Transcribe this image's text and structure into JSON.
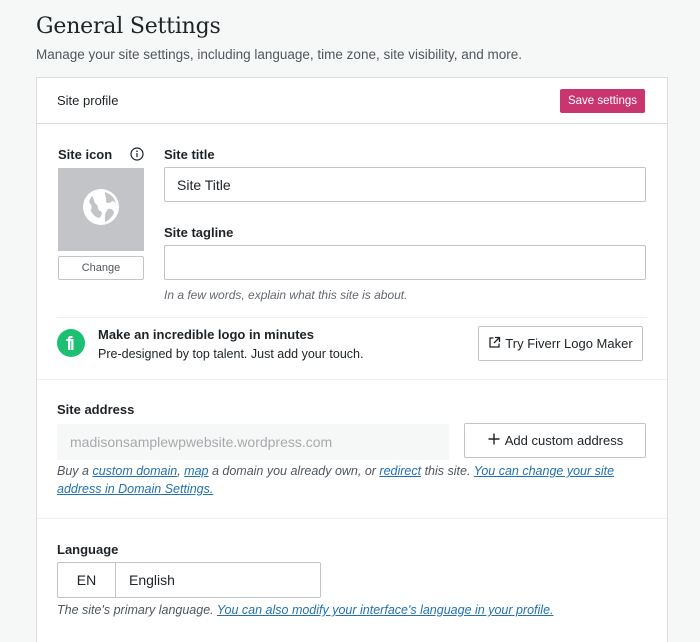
{
  "page": {
    "title": "General Settings",
    "subtitle": "Manage your site settings, including language, time zone, site visibility, and more."
  },
  "site_profile": {
    "header": "Site profile",
    "save_label": "Save settings",
    "site_icon_label": "Site icon",
    "change_label": "Change",
    "site_title_label": "Site title",
    "site_title_value": "Site Title",
    "tagline_label": "Site tagline",
    "tagline_value": "",
    "tagline_help": "In a few words, explain what this site is about."
  },
  "promo": {
    "title": "Make an incredible logo in minutes",
    "description": "Pre-designed by top talent. Just add your touch.",
    "button_label": "Try Fiverr Logo Maker"
  },
  "site_address": {
    "label": "Site address",
    "value": "madisonsamplewpwebsite.wordpress.com",
    "add_custom_label": "Add custom address",
    "help": {
      "t1": "Buy a ",
      "link_custom_domain": "custom domain",
      "t2": ", ",
      "link_map": "map",
      "t3": " a domain you already own, or ",
      "link_redirect": "redirect",
      "t4": " this site. ",
      "link_domain_settings": "You can change your site address in Domain Settings."
    }
  },
  "language": {
    "label": "Language",
    "code": "EN",
    "name": "English",
    "help_text": "The site's primary language. ",
    "help_link": "You can also modify your interface's language in your profile."
  },
  "colors": {
    "accent": "#c9356e",
    "link": "#2271b1",
    "fiverr_green": "#1dbf73",
    "icon_placeholder": "#c3c4c7"
  },
  "icons": [
    "info-icon",
    "globe-icon",
    "fiverr-logo-icon",
    "external-link-icon",
    "plus-icon"
  ]
}
